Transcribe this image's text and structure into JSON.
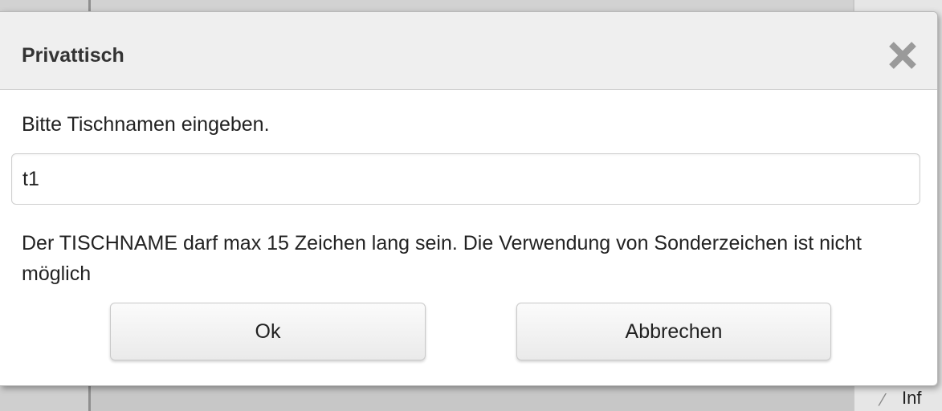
{
  "dialog": {
    "title": "Privattisch",
    "prompt": "Bitte Tischnamen eingeben.",
    "input_value": "t1",
    "hint": "Der TISCHNAME darf max 15 Zeichen lang sein. Die Verwendung von Sonderzeichen ist nicht möglich",
    "ok_label": "Ok",
    "cancel_label": "Abbrechen",
    "close_icon": "close-icon"
  },
  "background": {
    "info_text": "Inf",
    "info_icon": "pencil-icon"
  },
  "colors": {
    "header_bg": "#efefef",
    "close_icon": "#9a9a9a"
  }
}
